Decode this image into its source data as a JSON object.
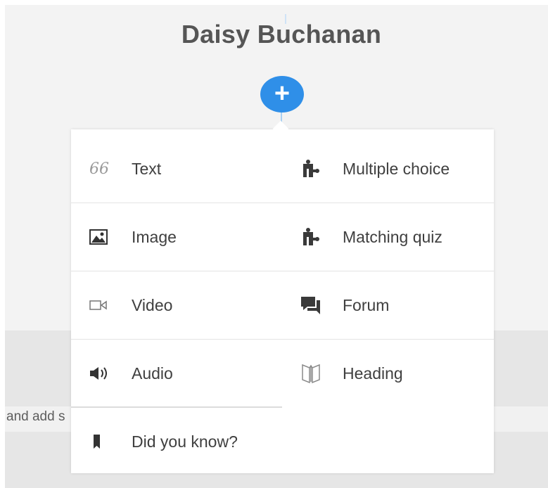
{
  "page": {
    "title": "Daisy Buchanan"
  },
  "add_button": {
    "symbol": "+"
  },
  "background_input": {
    "partial_text": "and add s"
  },
  "menu": {
    "items": [
      {
        "label": "Text",
        "icon": "quote-icon"
      },
      {
        "label": "Multiple choice",
        "icon": "puzzle-icon"
      },
      {
        "label": "Image",
        "icon": "image-icon"
      },
      {
        "label": "Matching quiz",
        "icon": "puzzle-icon"
      },
      {
        "label": "Video",
        "icon": "video-camera-icon"
      },
      {
        "label": "Forum",
        "icon": "chat-bubbles-icon"
      },
      {
        "label": "Audio",
        "icon": "speaker-icon"
      },
      {
        "label": "Heading",
        "icon": "open-book-icon"
      },
      {
        "label": "Did you know?",
        "icon": "bookmark-icon"
      }
    ]
  },
  "colors": {
    "accent": "#2f8fe8",
    "text": "#3f3f3f",
    "title": "#555555"
  }
}
